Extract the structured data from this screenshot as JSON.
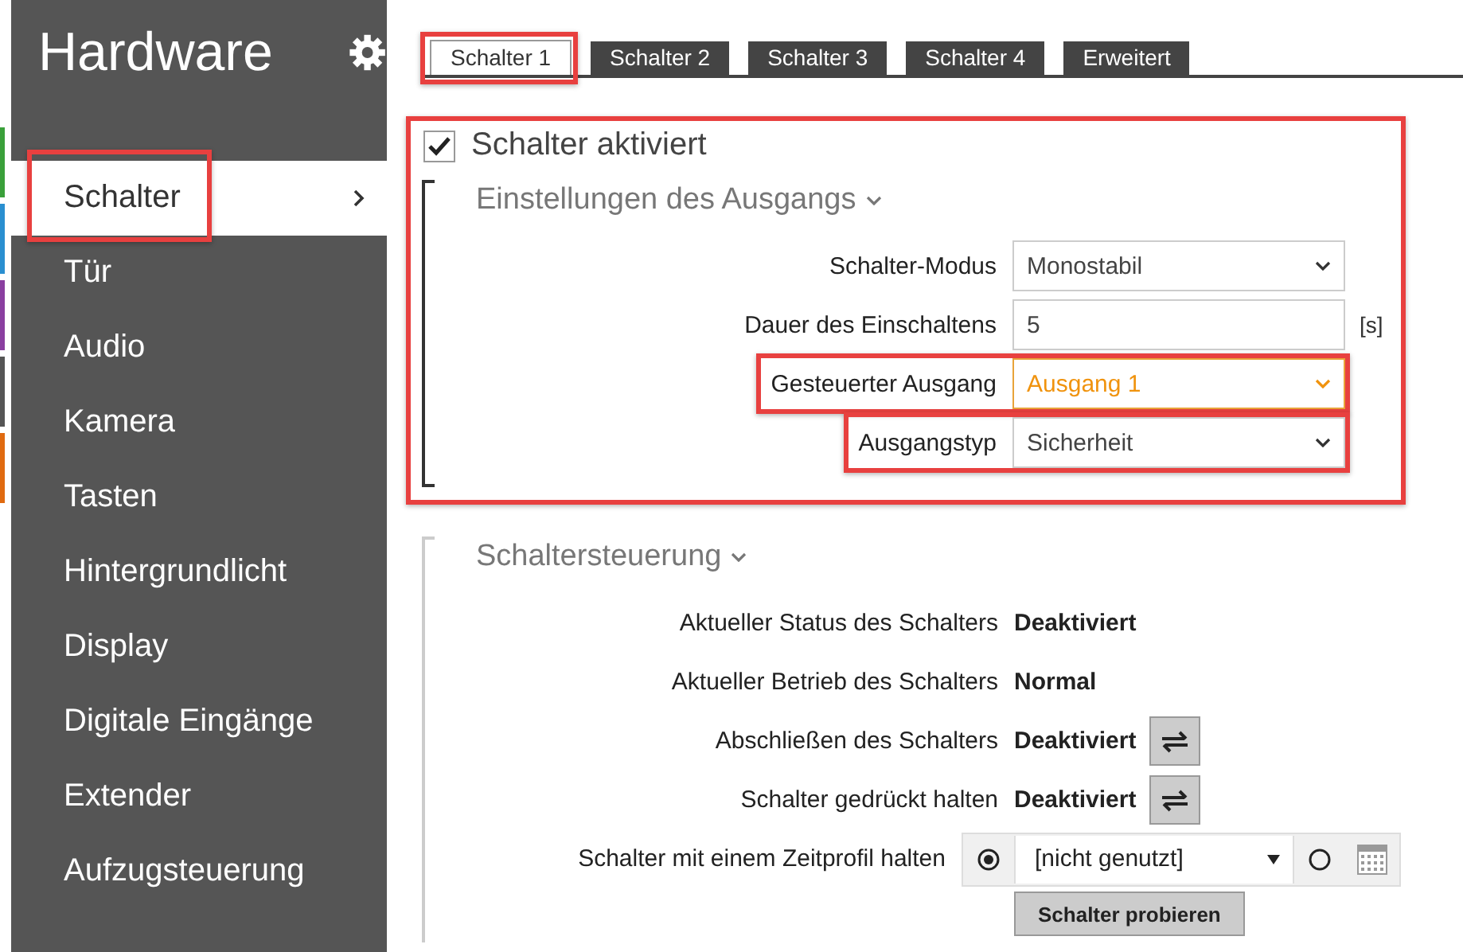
{
  "sidebar": {
    "title": "Hardware",
    "items": [
      {
        "label": "Schalter",
        "selected": true,
        "highlighted": true
      },
      {
        "label": "Tür",
        "selected": false,
        "highlighted": false
      },
      {
        "label": "Audio",
        "selected": false,
        "highlighted": false
      },
      {
        "label": "Kamera",
        "selected": false,
        "highlighted": false
      },
      {
        "label": "Tasten",
        "selected": false,
        "highlighted": false
      },
      {
        "label": "Hintergrundlicht",
        "selected": false,
        "highlighted": false
      },
      {
        "label": "Display",
        "selected": false,
        "highlighted": false
      },
      {
        "label": "Digitale Eingänge",
        "selected": false,
        "highlighted": false
      },
      {
        "label": "Extender",
        "selected": false,
        "highlighted": false
      },
      {
        "label": "Aufzugsteuerung",
        "selected": false,
        "highlighted": false
      }
    ]
  },
  "tabs": [
    {
      "label": "Schalter 1",
      "selected": true,
      "highlighted": true
    },
    {
      "label": "Schalter 2",
      "selected": false,
      "highlighted": false
    },
    {
      "label": "Schalter 3",
      "selected": false,
      "highlighted": false
    },
    {
      "label": "Schalter 4",
      "selected": false,
      "highlighted": false
    },
    {
      "label": "Erweitert",
      "selected": false,
      "highlighted": false
    }
  ],
  "switch_section": {
    "highlighted": true,
    "enabled": {
      "label": "Schalter aktiviert",
      "checked": true
    },
    "output_settings": {
      "title": "Einstellungen des Ausgangs",
      "fields": [
        {
          "kind": "select",
          "label": "Schalter-Modus",
          "value": "Monostabil",
          "focused": false,
          "highlighted": false
        },
        {
          "kind": "text",
          "label": "Dauer des Einschaltens",
          "value": "5",
          "unit": "[s]",
          "focused": false,
          "highlighted": false
        },
        {
          "kind": "select",
          "label": "Gesteuerter Ausgang",
          "value": "Ausgang 1",
          "focused": true,
          "highlighted": true
        },
        {
          "kind": "select",
          "label": "Ausgangstyp",
          "value": "Sicherheit",
          "focused": false,
          "highlighted": true
        }
      ]
    }
  },
  "switch_control": {
    "title": "Schaltersteuerung",
    "rows": [
      {
        "kind": "status",
        "label": "Aktueller Status des Schalters",
        "value": "Deaktiviert"
      },
      {
        "kind": "status",
        "label": "Aktueller Betrieb des Schalters",
        "value": "Normal"
      },
      {
        "kind": "toggle",
        "label": "Abschließen des Schalters",
        "value": "Deaktiviert"
      },
      {
        "kind": "toggle",
        "label": "Schalter gedrückt halten",
        "value": "Deaktiviert"
      },
      {
        "kind": "profile",
        "label": "Schalter mit einem Zeitprofil halten",
        "value": "[nicht genutzt]",
        "radios": [
          {
            "selected": true
          },
          {
            "selected": false
          }
        ]
      }
    ],
    "test_button": "Schalter probieren"
  }
}
